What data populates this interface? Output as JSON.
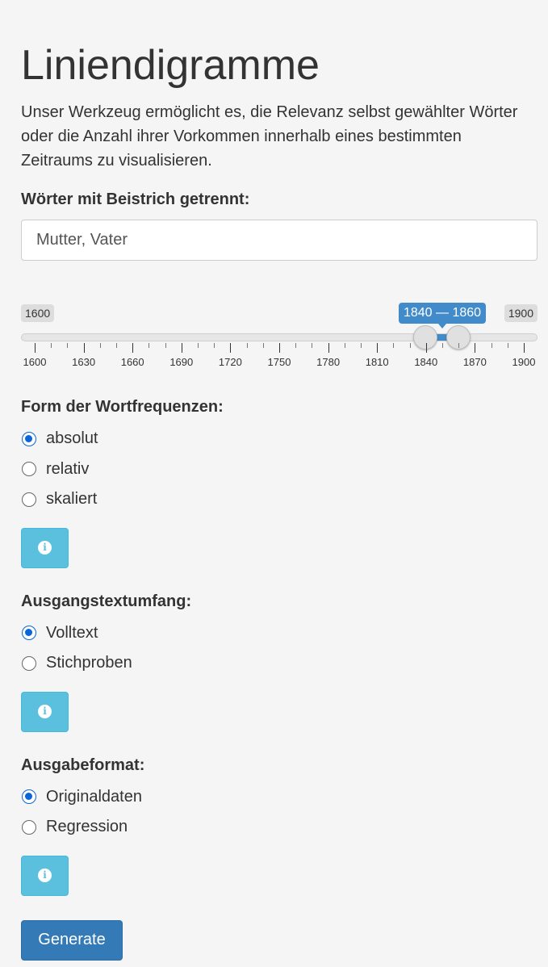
{
  "page": {
    "title": "Liniendigramme",
    "intro": "Unser Werkzeug ermöglicht es, die Relevanz selbst gewählter Wörter oder die Anzahl ihrer Vorkommen innerhalb eines bestimmten Zeitraums zu visualisieren."
  },
  "words": {
    "label": "Wörter mit Beistrich getrennt:",
    "value": "Mutter, Vater"
  },
  "slider": {
    "min_label": "1600",
    "max_label": "1900",
    "range_label": "1840 — 1860",
    "from": 1840,
    "to": 1860,
    "min": 1600,
    "max": 1900,
    "tick_labels": [
      "1600",
      "1630",
      "1660",
      "1690",
      "1720",
      "1750",
      "1780",
      "1810",
      "1840",
      "1870",
      "1900"
    ]
  },
  "frequency": {
    "label": "Form der Wortfrequenzen:",
    "options": [
      "absolut",
      "relativ",
      "skaliert"
    ],
    "selected": "absolut"
  },
  "scope": {
    "label": "Ausgangstextumfang:",
    "options": [
      "Volltext",
      "Stichproben"
    ],
    "selected": "Volltext"
  },
  "output": {
    "label": "Ausgabeformat:",
    "options": [
      "Originaldaten",
      "Regression"
    ],
    "selected": "Originaldaten"
  },
  "info_icon": "info-circle-icon",
  "generate_label": "Generate",
  "colors": {
    "accent": "#428bca",
    "info_button": "#5bc0de",
    "primary_button": "#337ab7",
    "radio_checked": "#0a66d8"
  }
}
